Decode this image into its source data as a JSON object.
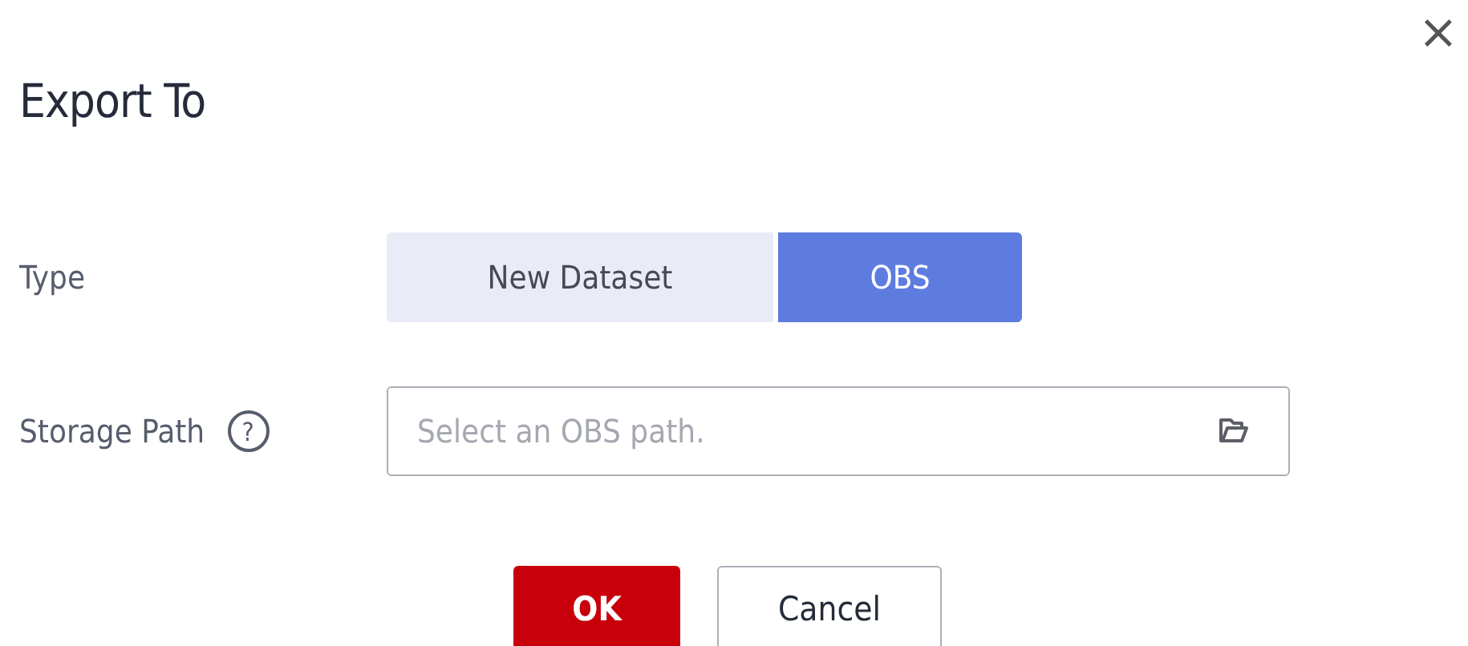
{
  "dialog": {
    "title": "Export To",
    "close": "×"
  },
  "fields": [
    {
      "kind": "segmented",
      "label": "Type",
      "options": [
        {
          "label": "New Dataset",
          "selected": false
        },
        {
          "label": "OBS",
          "selected": true
        }
      ]
    },
    {
      "kind": "path",
      "label": "Storage Path",
      "help": "?",
      "placeholder": "Select an OBS path."
    }
  ],
  "buttons": [
    {
      "label": "OK",
      "primary": true
    },
    {
      "label": "Cancel",
      "primary": false
    }
  ]
}
